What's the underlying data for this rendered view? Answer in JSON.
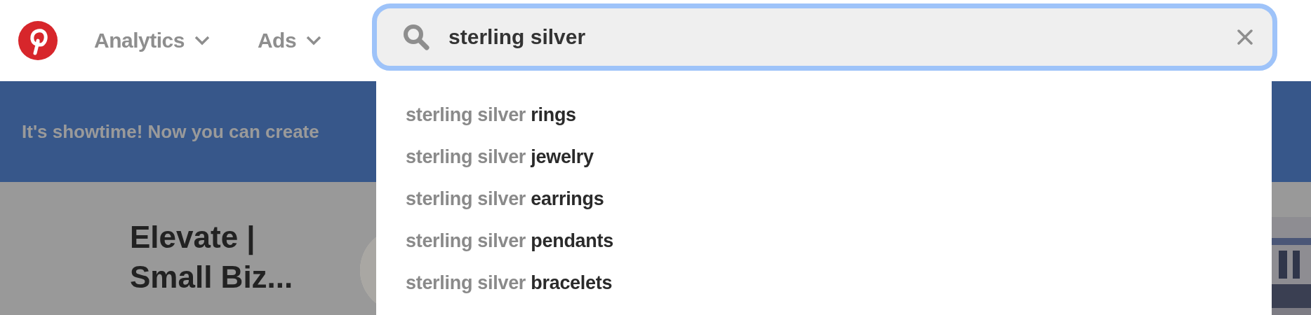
{
  "header": {
    "nav": [
      {
        "label": "Analytics",
        "has_menu": true
      },
      {
        "label": "Ads",
        "has_menu": true
      }
    ]
  },
  "search": {
    "value": "sterling silver",
    "focused": true,
    "suggestions": [
      {
        "text": "sterling silver **rings**"
      },
      {
        "text": "sterling silver **jewelry**"
      },
      {
        "text": "sterling silver **earrings**"
      },
      {
        "text": "sterling silver **pendants**"
      },
      {
        "text": "sterling silver **bracelets**"
      }
    ]
  },
  "banner": {
    "text": "It's showtime! Now you can create"
  },
  "card": {
    "title": "Elevate | Small Biz..."
  }
}
